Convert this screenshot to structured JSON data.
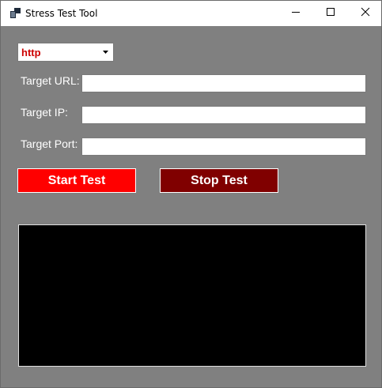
{
  "window": {
    "title": "Stress Test Tool",
    "app_icon": "app-window-icon",
    "controls": {
      "minimize_icon": "minimize-icon",
      "maximize_icon": "maximize-icon",
      "close_icon": "close-icon"
    },
    "background_color": "#808080"
  },
  "protocol": {
    "selected": "http",
    "color": "#cc0000",
    "dropdown_icon": "chevron-down-icon"
  },
  "fields": {
    "url": {
      "label": "Target URL:",
      "value": ""
    },
    "ip": {
      "label": "Target IP:",
      "value": ""
    },
    "port": {
      "label": "Target Port:",
      "value": ""
    }
  },
  "buttons": {
    "start_label": "Start Test",
    "start_color": "#ff0000",
    "stop_label": "Stop Test",
    "stop_color": "#800000"
  },
  "console": {
    "output": "",
    "background_color": "#000000"
  }
}
